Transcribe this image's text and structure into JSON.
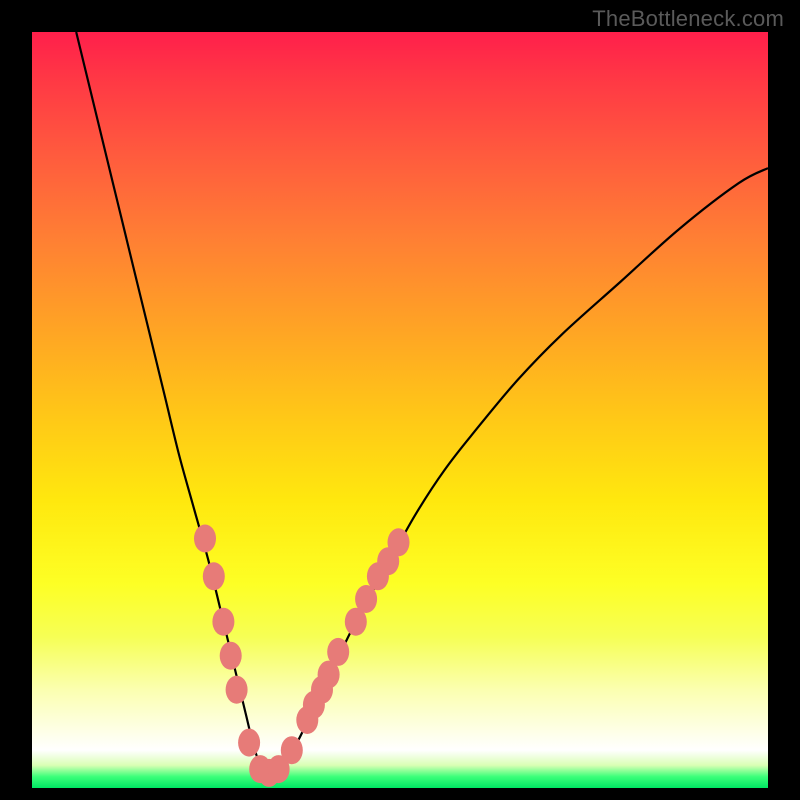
{
  "watermark": "TheBottleneck.com",
  "colors": {
    "frame": "#000000",
    "curve": "#000000",
    "marker_fill": "#e77b78",
    "marker_stroke": "#e77b78"
  },
  "chart_data": {
    "type": "line",
    "title": "",
    "xlabel": "",
    "ylabel": "",
    "xlim": [
      0,
      100
    ],
    "ylim": [
      0,
      100
    ],
    "grid": false,
    "legend": false,
    "series": [
      {
        "name": "bottleneck-curve",
        "x": [
          6,
          8,
          10,
          12,
          14,
          16,
          18,
          20,
          22,
          24,
          26,
          27,
          28,
          29,
          30,
          31,
          32,
          33,
          34,
          36,
          38,
          40,
          44,
          48,
          52,
          56,
          60,
          66,
          72,
          80,
          88,
          96,
          100
        ],
        "y": [
          100,
          92,
          84,
          76,
          68,
          60,
          52,
          44,
          37,
          30,
          22,
          18,
          14,
          10,
          6,
          3,
          2,
          2,
          3,
          6,
          10,
          14,
          22,
          29,
          36,
          42,
          47,
          54,
          60,
          67,
          74,
          80,
          82
        ]
      }
    ],
    "markers": [
      {
        "x": 23.5,
        "y": 33
      },
      {
        "x": 24.7,
        "y": 28
      },
      {
        "x": 26.0,
        "y": 22
      },
      {
        "x": 27.0,
        "y": 17.5
      },
      {
        "x": 27.8,
        "y": 13
      },
      {
        "x": 29.5,
        "y": 6
      },
      {
        "x": 31.0,
        "y": 2.5
      },
      {
        "x": 32.2,
        "y": 2
      },
      {
        "x": 33.5,
        "y": 2.5
      },
      {
        "x": 35.3,
        "y": 5
      },
      {
        "x": 37.4,
        "y": 9
      },
      {
        "x": 38.3,
        "y": 11
      },
      {
        "x": 39.4,
        "y": 13
      },
      {
        "x": 40.3,
        "y": 15
      },
      {
        "x": 41.6,
        "y": 18
      },
      {
        "x": 44.0,
        "y": 22
      },
      {
        "x": 45.4,
        "y": 25
      },
      {
        "x": 47.0,
        "y": 28
      },
      {
        "x": 48.4,
        "y": 30
      },
      {
        "x": 49.8,
        "y": 32.5
      }
    ]
  }
}
